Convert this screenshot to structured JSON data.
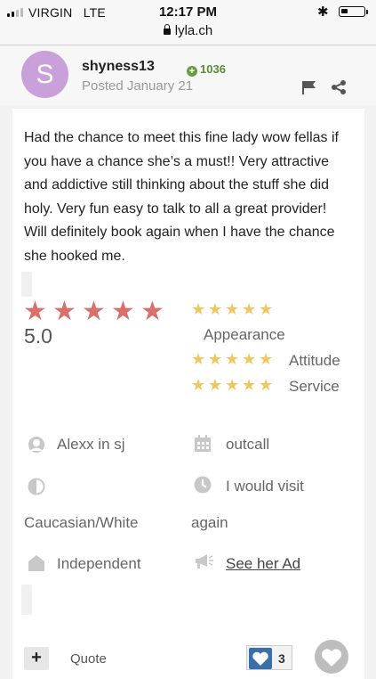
{
  "status_bar": {
    "carrier": "VIRGIN",
    "network": "LTE",
    "time": "12:17 PM",
    "url": "lyla.ch",
    "bluetooth": "✱"
  },
  "post": {
    "avatar_letter": "S",
    "username": "shyness13",
    "reputation": "1036",
    "posted": "Posted January 21",
    "body": "Had the chance to meet this fine lady wow fellas if you have a chance she’s a must!! Very attractive and addictive still thinking about the stuff she did holy. Very fun easy to talk to all a great provider! Will definitely book again when I have the chance she hooked me."
  },
  "rating": {
    "overall_stars": 5,
    "overall_score": "5.0",
    "categories": [
      {
        "label": "Appearance",
        "stars": 5
      },
      {
        "label": "Attitude",
        "stars": 5
      },
      {
        "label": "Service",
        "stars": 5
      }
    ]
  },
  "details": {
    "provider": "Alexx in sj",
    "call_type": "outcall",
    "ethnicity": "Caucasian/White",
    "visit_again_line1": "I would visit",
    "visit_again_line2": "again",
    "agency": "Independent",
    "ad_link": "See her Ad"
  },
  "actions": {
    "quote_label": "Quote",
    "like_count": "3"
  },
  "colors": {
    "avatar": "#c9a0d9",
    "rep_green": "#5c8a3a",
    "big_star": "#d9706b",
    "small_star": "#f0c75e",
    "like_blue": "#3a6fa7"
  }
}
